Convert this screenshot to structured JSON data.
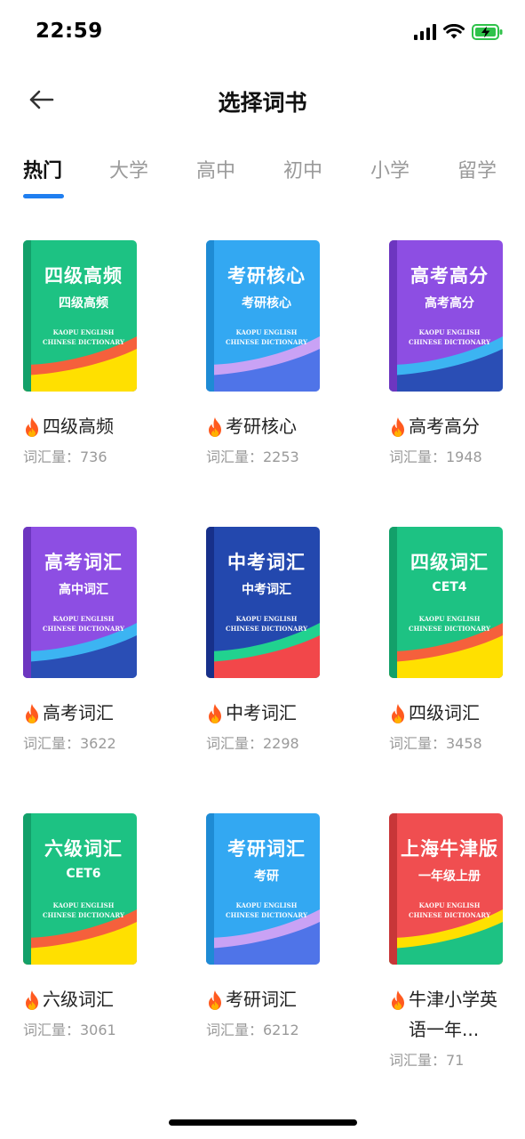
{
  "status": {
    "time": "22:59"
  },
  "header": {
    "title": "选择词书"
  },
  "tabs": [
    {
      "label": "热门",
      "active": true
    },
    {
      "label": "大学"
    },
    {
      "label": "高中"
    },
    {
      "label": "初中"
    },
    {
      "label": "小学"
    },
    {
      "label": "留学"
    }
  ],
  "books": [
    {
      "cover_title": "四级高频",
      "cover_sub": "四级高频",
      "cover_en_1": "KAOPU ENGLISH",
      "cover_en_2": "CHINESE DICTIONARY",
      "name": "四级高频",
      "count": "词汇量：736",
      "theme": "green"
    },
    {
      "cover_title": "考研核心",
      "cover_sub": "考研核心",
      "cover_en_1": "KAOPU ENGLISH",
      "cover_en_2": "CHINESE DICTIONARY",
      "name": "考研核心",
      "count": "词汇量：2253",
      "theme": "lightblue"
    },
    {
      "cover_title": "高考高分",
      "cover_sub": "高考高分",
      "cover_en_1": "KAOPU ENGLISH",
      "cover_en_2": "CHINESE DICTIONARY",
      "name": "高考高分",
      "count": "词汇量：1948",
      "theme": "purple"
    },
    {
      "cover_title": "高考词汇",
      "cover_sub": "高中词汇",
      "cover_en_1": "KAOPU ENGLISH",
      "cover_en_2": "CHINESE DICTIONARY",
      "name": "高考词汇",
      "count": "词汇量：3622",
      "theme": "purple"
    },
    {
      "cover_title": "中考词汇",
      "cover_sub": "中考词汇",
      "cover_en_1": "KAOPU ENGLISH",
      "cover_en_2": "CHINESE DICTIONARY",
      "name": "中考词汇",
      "count": "词汇量：2298",
      "theme": "navy"
    },
    {
      "cover_title": "四级词汇",
      "cover_sub": "CET4",
      "cover_en_1": "KAOPU ENGLISH",
      "cover_en_2": "CHINESE DICTIONARY",
      "name": "四级词汇",
      "count": "词汇量：3458",
      "theme": "green"
    },
    {
      "cover_title": "六级词汇",
      "cover_sub": "CET6",
      "cover_en_1": "KAOPU ENGLISH",
      "cover_en_2": "CHINESE DICTIONARY",
      "name": "六级词汇",
      "count": "词汇量：3061",
      "theme": "green"
    },
    {
      "cover_title": "考研词汇",
      "cover_sub": "考研",
      "cover_en_1": "KAOPU ENGLISH",
      "cover_en_2": "CHINESE DICTIONARY",
      "name": "考研词汇",
      "count": "词汇量：6212",
      "theme": "lightblue"
    },
    {
      "cover_title": "上海牛津版",
      "cover_sub": "一年级上册",
      "cover_en_1": "KAOPU ENGLISH",
      "cover_en_2": "CHINESE DICTIONARY",
      "name": "牛津小学英语一年...",
      "count": "词汇量：71",
      "theme": "red"
    }
  ],
  "themes": {
    "green": {
      "bg": "#1dc283",
      "spine": "#13a06a",
      "wave1": "#f5603c",
      "wave2": "#ffe000"
    },
    "lightblue": {
      "bg": "#33a8f2",
      "spine": "#1e8bd4",
      "wave1": "#c9a2f5",
      "wave2": "#4f74e8"
    },
    "purple": {
      "bg": "#8d4ee3",
      "spine": "#6d36c0",
      "wave1": "#3cb4f2",
      "wave2": "#2a4eb5"
    },
    "navy": {
      "bg": "#2348ae",
      "spine": "#17308a",
      "wave1": "#21d28f",
      "wave2": "#f2474a"
    },
    "red": {
      "bg": "#f04e50",
      "spine": "#c83638",
      "wave1": "#ffe000",
      "wave2": "#1dc283"
    }
  },
  "colors": {
    "accent": "#1f7ef0",
    "fire": "#ff5a1f"
  }
}
